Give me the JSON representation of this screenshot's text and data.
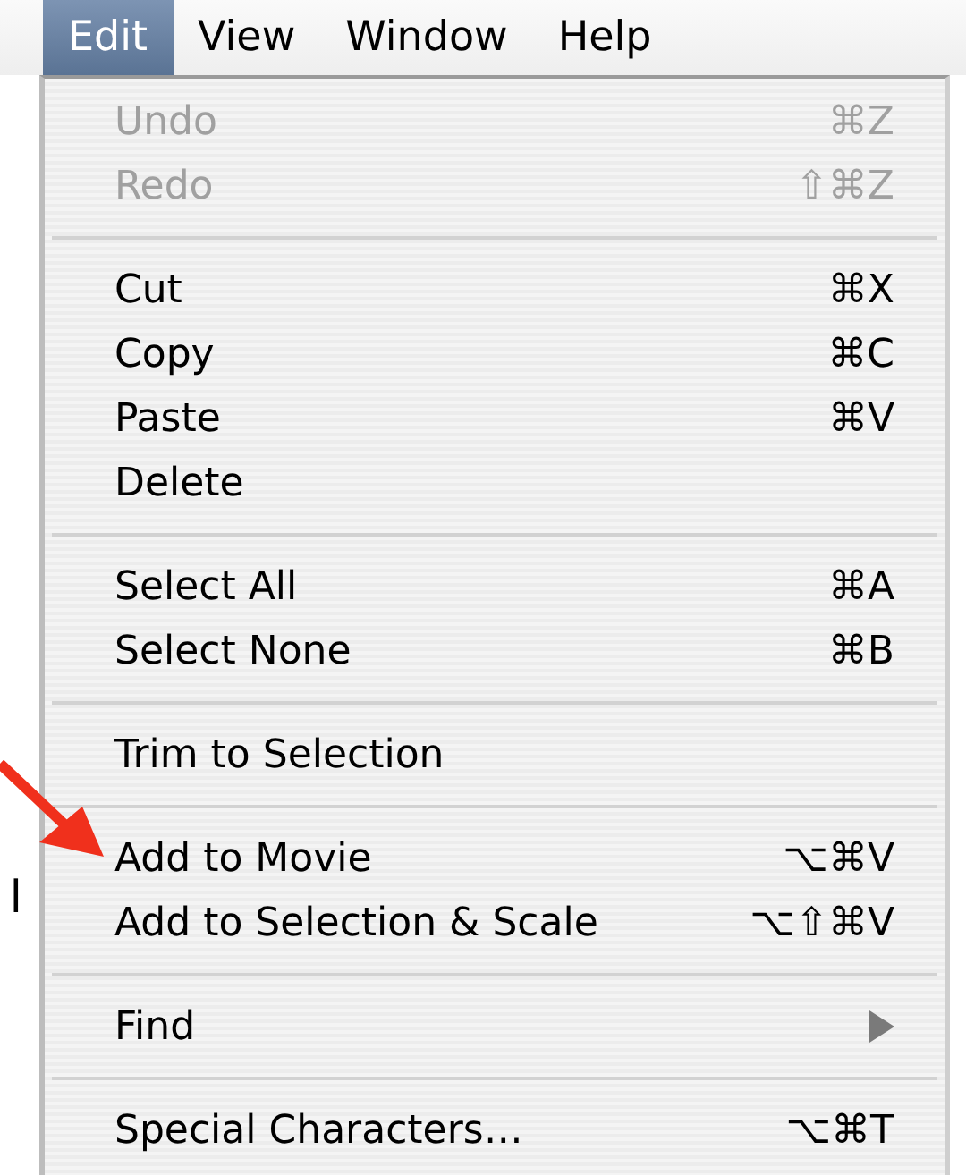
{
  "menubar": [
    {
      "label": "Edit",
      "selected": true
    },
    {
      "label": "View",
      "selected": false
    },
    {
      "label": "Window",
      "selected": false
    },
    {
      "label": "Help",
      "selected": false
    }
  ],
  "menu": [
    {
      "kind": "item",
      "label": "Undo",
      "shortcut": "⌘Z",
      "disabled": true
    },
    {
      "kind": "item",
      "label": "Redo",
      "shortcut": "⇧⌘Z",
      "disabled": true
    },
    {
      "kind": "separator"
    },
    {
      "kind": "item",
      "label": "Cut",
      "shortcut": "⌘X",
      "disabled": false
    },
    {
      "kind": "item",
      "label": "Copy",
      "shortcut": "⌘C",
      "disabled": false
    },
    {
      "kind": "item",
      "label": "Paste",
      "shortcut": "⌘V",
      "disabled": false
    },
    {
      "kind": "item",
      "label": "Delete",
      "disabled": false
    },
    {
      "kind": "separator"
    },
    {
      "kind": "item",
      "label": "Select All",
      "shortcut": "⌘A",
      "disabled": false
    },
    {
      "kind": "item",
      "label": "Select None",
      "shortcut": "⌘B",
      "disabled": false
    },
    {
      "kind": "separator"
    },
    {
      "kind": "item",
      "label": "Trim to Selection",
      "disabled": false
    },
    {
      "kind": "separator"
    },
    {
      "kind": "item",
      "label": "Add to Movie",
      "shortcut": "⌥⌘V",
      "disabled": false
    },
    {
      "kind": "item",
      "label": "Add to Selection & Scale",
      "shortcut": "⌥⇧⌘V",
      "disabled": false
    },
    {
      "kind": "separator"
    },
    {
      "kind": "submenu",
      "label": "Find",
      "disabled": false
    },
    {
      "kind": "separator"
    },
    {
      "kind": "item",
      "label": "Special Characters…",
      "shortcut": "⌥⌘T",
      "disabled": false
    }
  ],
  "side_text": "l"
}
